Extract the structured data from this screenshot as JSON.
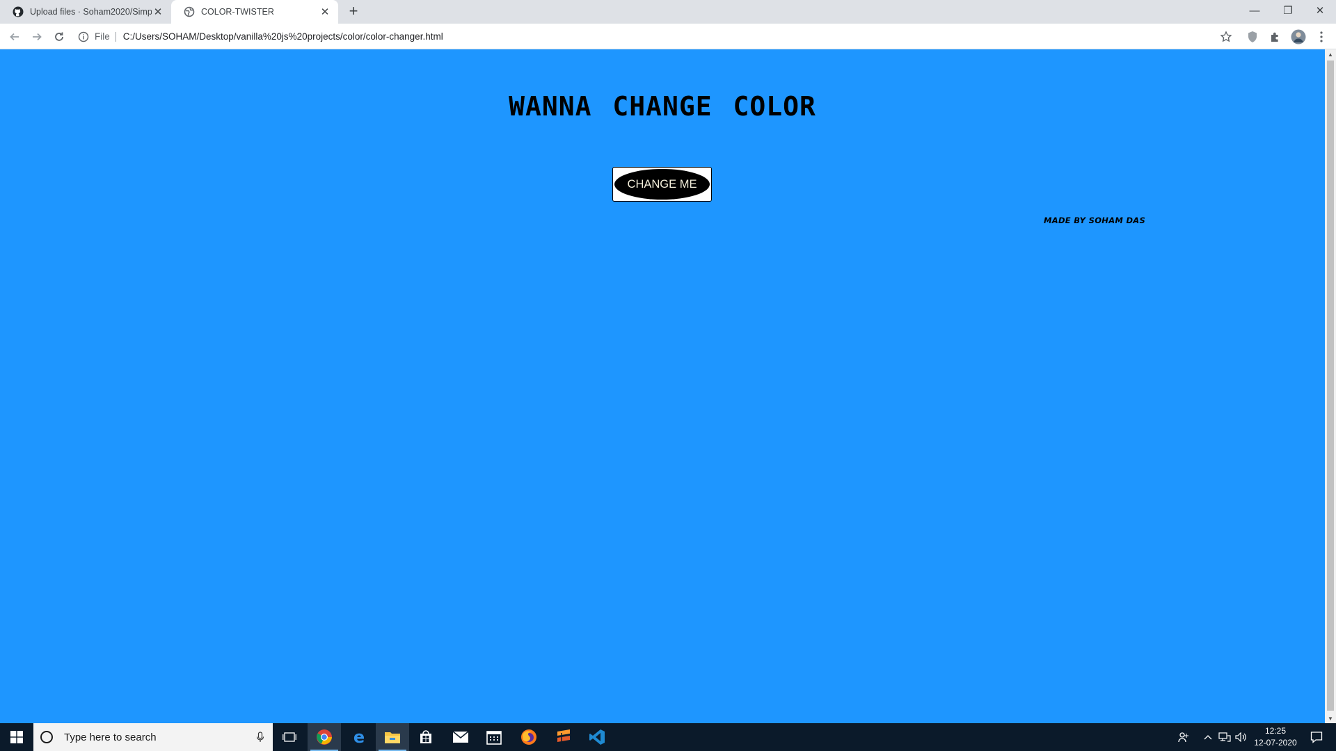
{
  "browser": {
    "tabs": [
      {
        "title": "Upload files · Soham2020/Simple",
        "active": false
      },
      {
        "title": "COLOR-TWISTER",
        "active": true
      }
    ],
    "new_tab": "+",
    "address": {
      "scheme_label": "File",
      "url": "C:/Users/SOHAM/Desktop/vanilla%20js%20projects/color/color-changer.html"
    }
  },
  "page": {
    "background_color": "#1e96ff",
    "heading": "WANNA CHANGE COLOR",
    "button_label": "CHANGE ME",
    "credit": "MADE BY SOHAM DAS"
  },
  "taskbar": {
    "search_placeholder": "Type here to search",
    "time": "12:25",
    "date": "12-07-2020",
    "pinned_icons": [
      "task-view-icon",
      "chrome-icon",
      "edge-icon",
      "file-explorer-icon",
      "store-icon",
      "mail-icon",
      "calendar-icon",
      "firefox-icon",
      "sublime-icon",
      "vscode-icon"
    ]
  }
}
